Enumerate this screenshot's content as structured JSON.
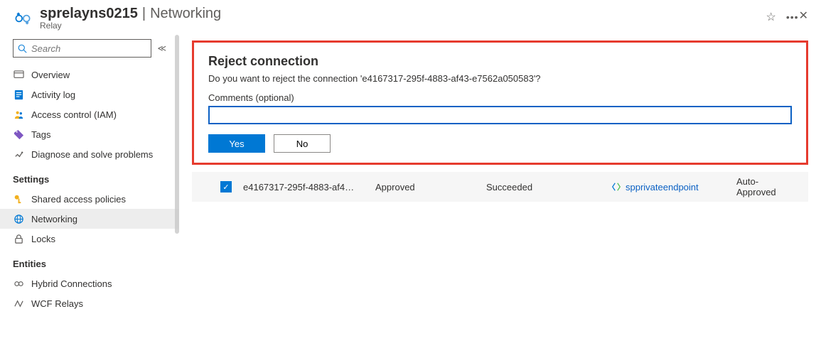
{
  "header": {
    "resource_name": "sprelayns0215",
    "page_name": "Networking",
    "resource_type": "Relay"
  },
  "sidebar": {
    "search_placeholder": "Search",
    "items": {
      "overview": "Overview",
      "activity_log": "Activity log",
      "access_control": "Access control (IAM)",
      "tags": "Tags",
      "diagnose": "Diagnose and solve problems"
    },
    "settings_header": "Settings",
    "settings": {
      "shared_access": "Shared access policies",
      "networking": "Networking",
      "locks": "Locks"
    },
    "entities_header": "Entities",
    "entities": {
      "hybrid": "Hybrid Connections",
      "wcf": "WCF Relays"
    }
  },
  "dialog": {
    "title": "Reject connection",
    "message": "Do you want to reject the connection 'e4167317-295f-4883-af43-e7562a050583'?",
    "comments_label": "Comments (optional)",
    "yes": "Yes",
    "no": "No"
  },
  "row": {
    "name": "e4167317-295f-4883-af4…",
    "connection_state": "Approved",
    "provisioning_state": "Succeeded",
    "private_endpoint": "spprivateendpoint",
    "description": "Auto-Approved"
  }
}
